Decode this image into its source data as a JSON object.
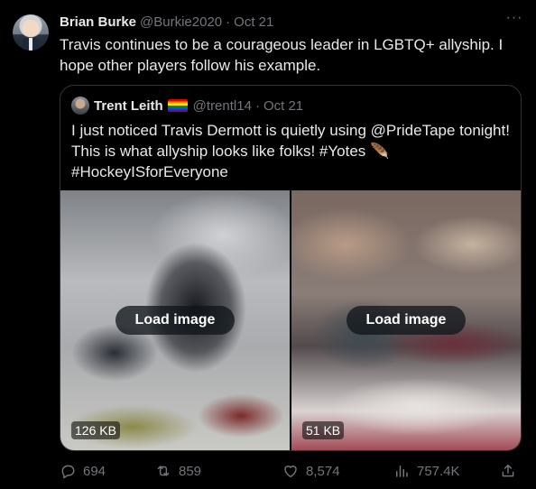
{
  "author": {
    "name": "Brian Burke",
    "handle": "@Burkie2020",
    "separator": "·",
    "date": "Oct 21"
  },
  "tweet_text": "Travis continues to be a courageous leader in LGBTQ+ allyship. I hope other players follow his example.",
  "more_label": "···",
  "quoted": {
    "name": "Trent Leith",
    "handle": "@trentl14",
    "separator": "·",
    "date": "Oct 21",
    "text": "I just noticed Travis Dermott is quietly using @PrideTape tonight! This is what allyship looks like folks! #Yotes 🪶 #HockeyISforEveryone",
    "images": [
      {
        "button_label": "Load image",
        "size_label": "126 KB"
      },
      {
        "button_label": "Load image",
        "size_label": "51 KB"
      }
    ]
  },
  "actions": {
    "replies": "694",
    "retweets": "859",
    "likes": "8,574",
    "views": "757.4K"
  },
  "icons": {
    "reply": "comment-bubble-icon",
    "retweet": "retweet-icon",
    "like": "heart-icon",
    "views": "bar-chart-icon",
    "share": "share-icon",
    "flag": "rainbow-flag-icon"
  },
  "colors": {
    "background": "#000000",
    "text_primary": "#e7e9ea",
    "text_secondary": "#71767b",
    "border": "#2f3336"
  }
}
